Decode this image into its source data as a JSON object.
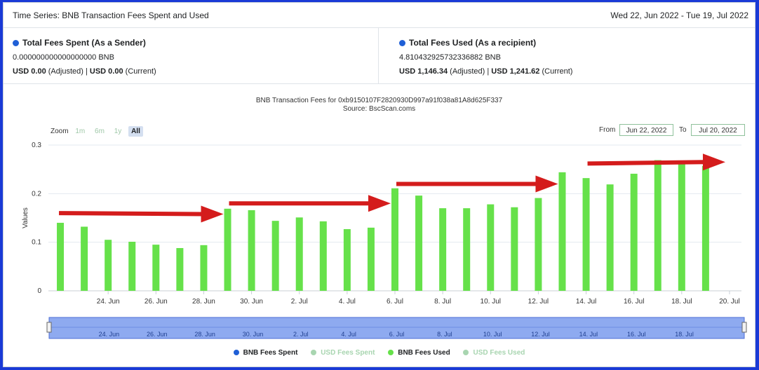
{
  "header": {
    "title": "Time Series: BNB Transaction Fees Spent and Used",
    "date_range": "Wed 22, Jun 2022 - Tue 19, Jul 2022"
  },
  "stats": {
    "spent": {
      "title": "Total Fees Spent (As a Sender)",
      "value": "0.000000000000000000 BNB",
      "usd_adjusted": "USD 0.00",
      "usd_adjusted_suffix": "(Adjusted) |",
      "usd_current": "USD 0.00",
      "usd_current_suffix": "(Current)"
    },
    "used": {
      "title": "Total Fees Used (As a recipient)",
      "value": "4.810432925732336882 BNB",
      "usd_adjusted": "USD 1,146.34",
      "usd_adjusted_suffix": "(Adjusted) |",
      "usd_current": "USD 1,241.62",
      "usd_current_suffix": "(Current)"
    },
    "dot_color": "#1f5fd6"
  },
  "controls": {
    "zoom_label": "Zoom",
    "zoom_options": [
      "1m",
      "6m",
      "1y",
      "All"
    ],
    "zoom_active": "All",
    "from_label": "From",
    "from_value": "Jun 22, 2022",
    "to_label": "To",
    "to_value": "Jul 20, 2022"
  },
  "chart_data": {
    "type": "bar",
    "title": "BNB Transaction Fees for 0xb9150107F2820930D997a91f038a81A8d625F337",
    "subtitle": "Source: BscScan.coms",
    "ylabel": "Values",
    "xlabel": "",
    "ylim": [
      0,
      0.3
    ],
    "y_ticks": [
      "0",
      "0.1",
      "0.2",
      "0.3"
    ],
    "grid": true,
    "categories": [
      "2022-06-22",
      "2022-06-23",
      "2022-06-24",
      "2022-06-25",
      "2022-06-26",
      "2022-06-27",
      "2022-06-28",
      "2022-06-29",
      "2022-06-30",
      "2022-07-01",
      "2022-07-02",
      "2022-07-03",
      "2022-07-04",
      "2022-07-05",
      "2022-07-06",
      "2022-07-07",
      "2022-07-08",
      "2022-07-09",
      "2022-07-10",
      "2022-07-11",
      "2022-07-12",
      "2022-07-13",
      "2022-07-14",
      "2022-07-15",
      "2022-07-16",
      "2022-07-17",
      "2022-07-18",
      "2022-07-19",
      "2022-07-20"
    ],
    "x_tick_labels": [
      "24. Jun",
      "26. Jun",
      "28. Jun",
      "30. Jun",
      "2. Jul",
      "4. Jul",
      "6. Jul",
      "8. Jul",
      "10. Jul",
      "12. Jul",
      "14. Jul",
      "16. Jul",
      "18. Jul",
      "20. Jul"
    ],
    "series": [
      {
        "name": "BNB Fees Spent",
        "color": "#1f5fd6",
        "visible": true,
        "values": []
      },
      {
        "name": "USD Fees Spent",
        "color": "#a8d5b0",
        "visible": false,
        "values": []
      },
      {
        "name": "BNB Fees Used",
        "color": "#66e14a",
        "visible": true,
        "values": [
          0.14,
          0.132,
          0.105,
          0.101,
          0.095,
          0.088,
          0.094,
          0.169,
          0.166,
          0.144,
          0.151,
          0.143,
          0.127,
          0.13,
          0.211,
          0.196,
          0.17,
          0.17,
          0.178,
          0.172,
          0.191,
          0.244,
          0.232,
          0.219,
          0.241,
          0.269,
          0.267,
          0.257,
          0.0
        ]
      },
      {
        "name": "USD Fees Used",
        "color": "#a8d5b0",
        "visible": false,
        "values": []
      }
    ],
    "navigator_labels": [
      "24. Jun",
      "26. Jun",
      "28. Jun",
      "30. Jun",
      "2. Jul",
      "4. Jul",
      "6. Jul",
      "8. Jul",
      "10. Jul",
      "12. Jul",
      "14. Jul",
      "16. Jul",
      "18. Jul"
    ],
    "annotations": {
      "arrows_color": "#d41c1c",
      "arrows": [
        {
          "from": [
            "2022-06-22",
            0.16
          ],
          "to": [
            "2022-06-29",
            0.158
          ]
        },
        {
          "from": [
            "2022-06-29",
            0.18
          ],
          "to": [
            "2022-07-06",
            0.18
          ]
        },
        {
          "from": [
            "2022-07-06",
            0.22
          ],
          "to": [
            "2022-07-13",
            0.22
          ]
        },
        {
          "from": [
            "2022-07-14",
            0.262
          ],
          "to": [
            "2022-07-20",
            0.265
          ]
        }
      ]
    }
  }
}
